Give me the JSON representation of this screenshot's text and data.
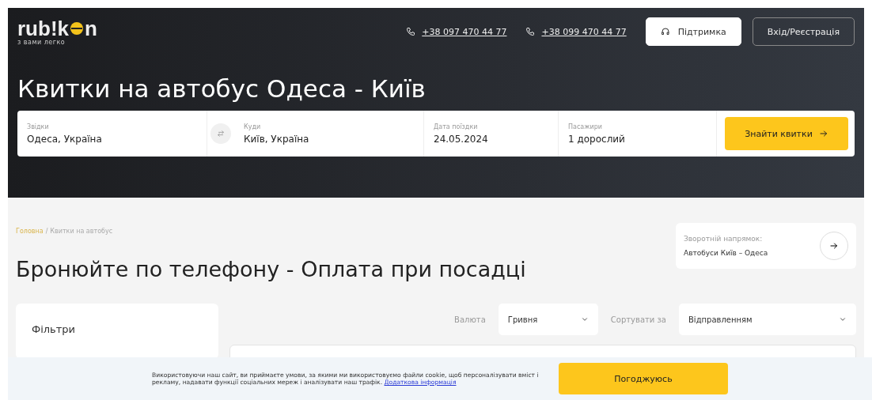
{
  "header": {
    "logo": "rub!k",
    "logo_tail": "n",
    "logo_tagline": "з вами легко",
    "phones": [
      "+38 097 470 44 77",
      "+38 099 470 44 77"
    ],
    "support_button": "Підтримка",
    "login_button": "Вхід/Реєстрація"
  },
  "hero": {
    "title": "Квитки на автобус Одеса - Київ"
  },
  "search": {
    "fields": [
      {
        "kind": "place",
        "label": "Звідки",
        "value": "Одеса, Україна"
      },
      {
        "kind": "swap"
      },
      {
        "kind": "place",
        "label": "Куди",
        "value": "Київ, Україна"
      },
      {
        "kind": "date",
        "label": "Дата поїздки",
        "value": "24.05.2024"
      },
      {
        "kind": "people",
        "label": "Пасажири",
        "value": "1 дорослий"
      }
    ],
    "button": "Знайти квитки"
  },
  "breadcrumb_separator": "/",
  "breadcrumbs": [
    {
      "label": "Головна",
      "selected": false
    },
    {
      "label": "Квитки на автобус",
      "selected": true
    }
  ],
  "page_title": "Бронюйте по телефону - Оплата при посадці",
  "reverse": {
    "label": "Зворотній напрямок:",
    "route": "Автобуси Київ – Одеса"
  },
  "filters": {
    "title": "Фільтри"
  },
  "controls": [
    {
      "label": "Валюта",
      "value": "Гривня"
    },
    {
      "label": "Сортувати за",
      "value": "Відправленням"
    }
  ],
  "cookie": {
    "text": "Використовуючи наш сайт, ви приймаєте умови, за якими ми використовуємо файли cookie, щоб персоналізувати вміст і рекламу, надавати функції соціальних мереж і аналізувати наш трафік.",
    "link": "Додаткова інформація",
    "button": "Погоджуюсь"
  }
}
